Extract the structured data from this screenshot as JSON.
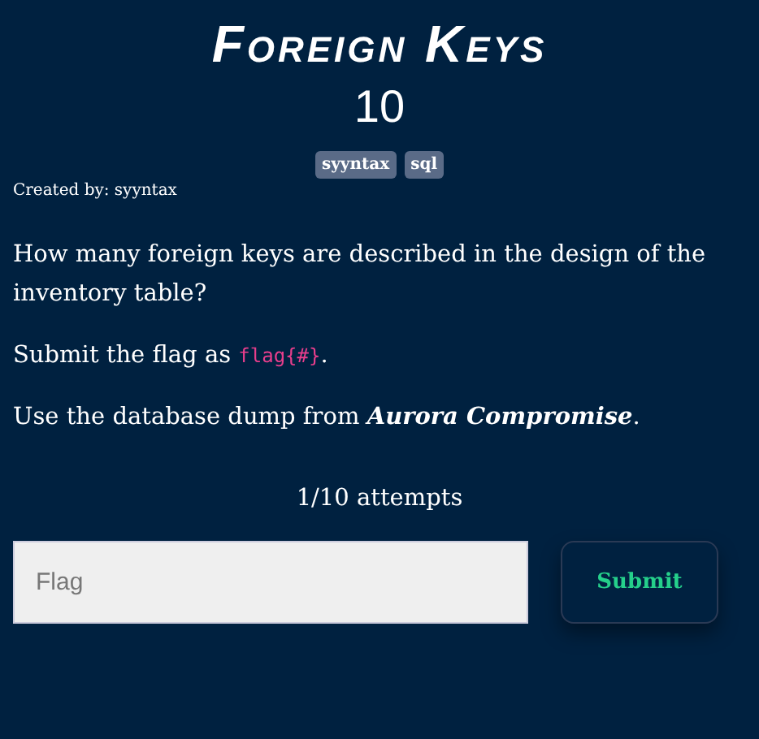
{
  "challenge": {
    "title": "Foreign Keys",
    "value": "10",
    "tags": [
      "syyntax",
      "sql"
    ],
    "author": "Created by: syyntax",
    "description": [
      [
        {
          "kind": "text",
          "text": "How many foreign keys are described in the design of the inventory table?"
        }
      ],
      [
        {
          "kind": "text",
          "text": "Submit the flag as "
        },
        {
          "kind": "code",
          "text": "flag{#}"
        },
        {
          "kind": "text",
          "text": "."
        }
      ],
      [
        {
          "kind": "text",
          "text": "Use the database dump from "
        },
        {
          "kind": "emphasis",
          "text": "Aurora Compromise"
        },
        {
          "kind": "text",
          "text": "."
        }
      ]
    ]
  },
  "attempts": "1/10 attempts",
  "flag_field": {
    "placeholder": "Flag"
  },
  "submit_button": "Submit"
}
